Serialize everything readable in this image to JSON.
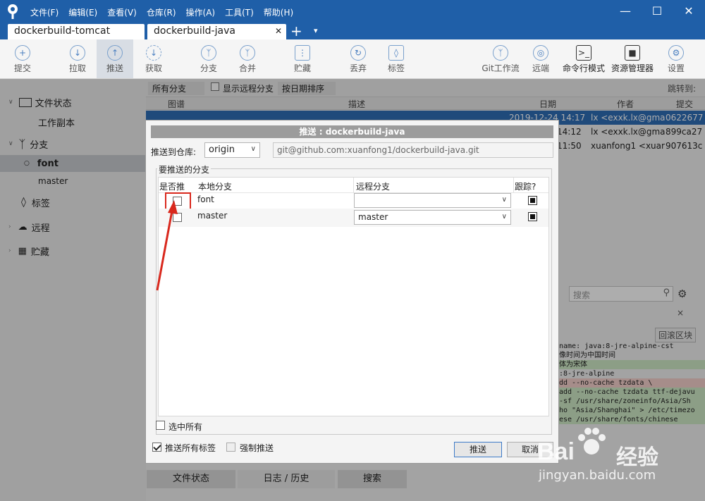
{
  "window": {
    "menu": [
      "文件(F)",
      "编辑(E)",
      "查看(V)",
      "仓库(R)",
      "操作(A)",
      "工具(T)",
      "帮助(H)"
    ],
    "tabs": [
      "dockerbuild-tomcat",
      "dockerbuild-java"
    ],
    "tab_close": "✕",
    "tab_add": "+",
    "tab_more": "▾"
  },
  "toolbar": {
    "commit": "提交",
    "pull": "拉取",
    "push": "推送",
    "fetch": "获取",
    "branch": "分支",
    "merge": "合并",
    "stash": "贮藏",
    "discard": "丢弃",
    "tag": "标签",
    "gitflow": "Git工作流",
    "remote": "远端",
    "terminal": "命令行模式",
    "explorer": "资源管理器",
    "settings": "设置"
  },
  "sidebar": {
    "file_status": "文件状态",
    "working_copy": "工作副本",
    "branches": "分支",
    "branch_font": "font",
    "branch_master": "master",
    "tags": "标签",
    "remotes": "远程",
    "stashes": "贮藏"
  },
  "filterbar": {
    "all_branches": "所有分支",
    "show_remote": "显示远程分支",
    "sort_by_date": "按日期排序",
    "jump_to": "跳转到:"
  },
  "columns": {
    "graph": "图谱",
    "description": "描述",
    "date": "日期",
    "author": "作者",
    "commit": "提交"
  },
  "commits": [
    {
      "date": "2019-12-24 14:17",
      "author": "lx <exxk.lx@gma",
      "hash": "0622677"
    },
    {
      "date": "14:12",
      "author": "lx <exxk.lx@gma",
      "hash": "899ca27"
    },
    {
      "date": "11:50",
      "author": "xuanfong1 <xuar",
      "hash": "907613c"
    }
  ],
  "right_panel": {
    "search_placeholder": "搜索",
    "rollback_block": "回滚区块",
    "diff_lines": [
      "name: java:8-jre-alpine-cst",
      "像时间为中国时间",
      "体为宋体",
      ":8-jre-alpine",
      "dd --no-cache tzdata \\",
      "add --no-cache tzdata ttf-dejavu",
      "-sf /usr/share/zoneinfo/Asia/Sh",
      "ho \"Asia/Shanghai\" > /etc/timezo",
      "ese /usr/share/fonts/chinese"
    ]
  },
  "dialog": {
    "title": "推送 : dockerbuild-java",
    "push_to_repo_label": "推送到仓库:",
    "repo_selected": "origin",
    "repo_url": "git@github.com:xuanfong1/dockerbuild-java.git",
    "branches_group": "要推送的分支",
    "col_push": "是否推",
    "col_local": "本地分支",
    "col_remote": "远程分支",
    "col_track": "跟踪?",
    "rows": [
      {
        "local": "font",
        "remote": ""
      },
      {
        "local": "master",
        "remote": "master"
      }
    ],
    "select_all": "选中所有",
    "push_all_tags": "推送所有标签",
    "force_push": "强制推送",
    "push_button": "推送",
    "cancel_button": "取消"
  },
  "bottom_tabs": [
    "文件状态",
    "日志 / 历史",
    "搜索"
  ],
  "watermark": {
    "brand": "Bai",
    "brand2": "经验",
    "url": "jingyan.baidu.com"
  },
  "colors": {
    "titlebar": "#1f5fa8",
    "highlight_red": "#d9281d",
    "selection": "#2f6db6"
  }
}
